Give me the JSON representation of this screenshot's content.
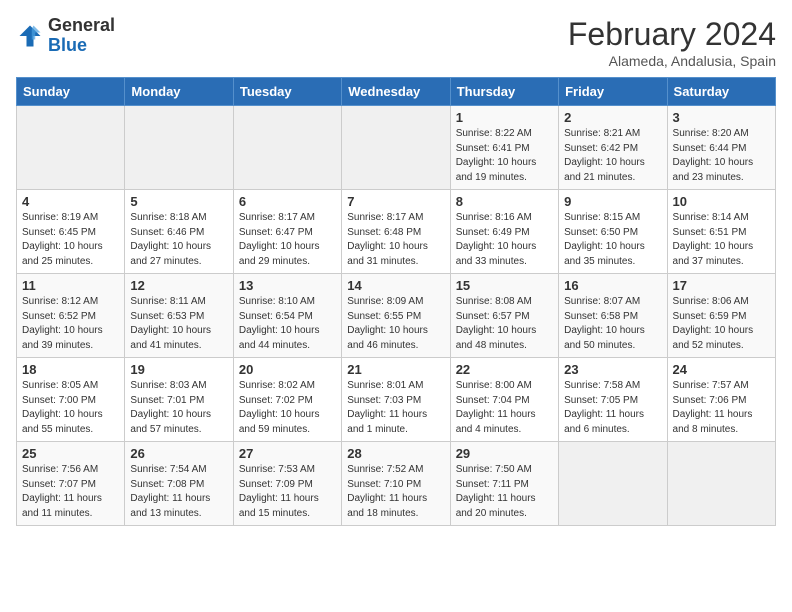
{
  "header": {
    "logo_general": "General",
    "logo_blue": "Blue",
    "month_title": "February 2024",
    "subtitle": "Alameda, Andalusia, Spain"
  },
  "days_of_week": [
    "Sunday",
    "Monday",
    "Tuesday",
    "Wednesday",
    "Thursday",
    "Friday",
    "Saturday"
  ],
  "weeks": [
    [
      {
        "day": "",
        "info": "",
        "empty": true
      },
      {
        "day": "",
        "info": "",
        "empty": true
      },
      {
        "day": "",
        "info": "",
        "empty": true
      },
      {
        "day": "",
        "info": "",
        "empty": true
      },
      {
        "day": "1",
        "info": "Sunrise: 8:22 AM\nSunset: 6:41 PM\nDaylight: 10 hours\nand 19 minutes."
      },
      {
        "day": "2",
        "info": "Sunrise: 8:21 AM\nSunset: 6:42 PM\nDaylight: 10 hours\nand 21 minutes."
      },
      {
        "day": "3",
        "info": "Sunrise: 8:20 AM\nSunset: 6:44 PM\nDaylight: 10 hours\nand 23 minutes."
      }
    ],
    [
      {
        "day": "4",
        "info": "Sunrise: 8:19 AM\nSunset: 6:45 PM\nDaylight: 10 hours\nand 25 minutes."
      },
      {
        "day": "5",
        "info": "Sunrise: 8:18 AM\nSunset: 6:46 PM\nDaylight: 10 hours\nand 27 minutes."
      },
      {
        "day": "6",
        "info": "Sunrise: 8:17 AM\nSunset: 6:47 PM\nDaylight: 10 hours\nand 29 minutes."
      },
      {
        "day": "7",
        "info": "Sunrise: 8:17 AM\nSunset: 6:48 PM\nDaylight: 10 hours\nand 31 minutes."
      },
      {
        "day": "8",
        "info": "Sunrise: 8:16 AM\nSunset: 6:49 PM\nDaylight: 10 hours\nand 33 minutes."
      },
      {
        "day": "9",
        "info": "Sunrise: 8:15 AM\nSunset: 6:50 PM\nDaylight: 10 hours\nand 35 minutes."
      },
      {
        "day": "10",
        "info": "Sunrise: 8:14 AM\nSunset: 6:51 PM\nDaylight: 10 hours\nand 37 minutes."
      }
    ],
    [
      {
        "day": "11",
        "info": "Sunrise: 8:12 AM\nSunset: 6:52 PM\nDaylight: 10 hours\nand 39 minutes."
      },
      {
        "day": "12",
        "info": "Sunrise: 8:11 AM\nSunset: 6:53 PM\nDaylight: 10 hours\nand 41 minutes."
      },
      {
        "day": "13",
        "info": "Sunrise: 8:10 AM\nSunset: 6:54 PM\nDaylight: 10 hours\nand 44 minutes."
      },
      {
        "day": "14",
        "info": "Sunrise: 8:09 AM\nSunset: 6:55 PM\nDaylight: 10 hours\nand 46 minutes."
      },
      {
        "day": "15",
        "info": "Sunrise: 8:08 AM\nSunset: 6:57 PM\nDaylight: 10 hours\nand 48 minutes."
      },
      {
        "day": "16",
        "info": "Sunrise: 8:07 AM\nSunset: 6:58 PM\nDaylight: 10 hours\nand 50 minutes."
      },
      {
        "day": "17",
        "info": "Sunrise: 8:06 AM\nSunset: 6:59 PM\nDaylight: 10 hours\nand 52 minutes."
      }
    ],
    [
      {
        "day": "18",
        "info": "Sunrise: 8:05 AM\nSunset: 7:00 PM\nDaylight: 10 hours\nand 55 minutes."
      },
      {
        "day": "19",
        "info": "Sunrise: 8:03 AM\nSunset: 7:01 PM\nDaylight: 10 hours\nand 57 minutes."
      },
      {
        "day": "20",
        "info": "Sunrise: 8:02 AM\nSunset: 7:02 PM\nDaylight: 10 hours\nand 59 minutes."
      },
      {
        "day": "21",
        "info": "Sunrise: 8:01 AM\nSunset: 7:03 PM\nDaylight: 11 hours\nand 1 minute."
      },
      {
        "day": "22",
        "info": "Sunrise: 8:00 AM\nSunset: 7:04 PM\nDaylight: 11 hours\nand 4 minutes."
      },
      {
        "day": "23",
        "info": "Sunrise: 7:58 AM\nSunset: 7:05 PM\nDaylight: 11 hours\nand 6 minutes."
      },
      {
        "day": "24",
        "info": "Sunrise: 7:57 AM\nSunset: 7:06 PM\nDaylight: 11 hours\nand 8 minutes."
      }
    ],
    [
      {
        "day": "25",
        "info": "Sunrise: 7:56 AM\nSunset: 7:07 PM\nDaylight: 11 hours\nand 11 minutes."
      },
      {
        "day": "26",
        "info": "Sunrise: 7:54 AM\nSunset: 7:08 PM\nDaylight: 11 hours\nand 13 minutes."
      },
      {
        "day": "27",
        "info": "Sunrise: 7:53 AM\nSunset: 7:09 PM\nDaylight: 11 hours\nand 15 minutes."
      },
      {
        "day": "28",
        "info": "Sunrise: 7:52 AM\nSunset: 7:10 PM\nDaylight: 11 hours\nand 18 minutes."
      },
      {
        "day": "29",
        "info": "Sunrise: 7:50 AM\nSunset: 7:11 PM\nDaylight: 11 hours\nand 20 minutes."
      },
      {
        "day": "",
        "info": "",
        "empty": true
      },
      {
        "day": "",
        "info": "",
        "empty": true
      }
    ]
  ]
}
